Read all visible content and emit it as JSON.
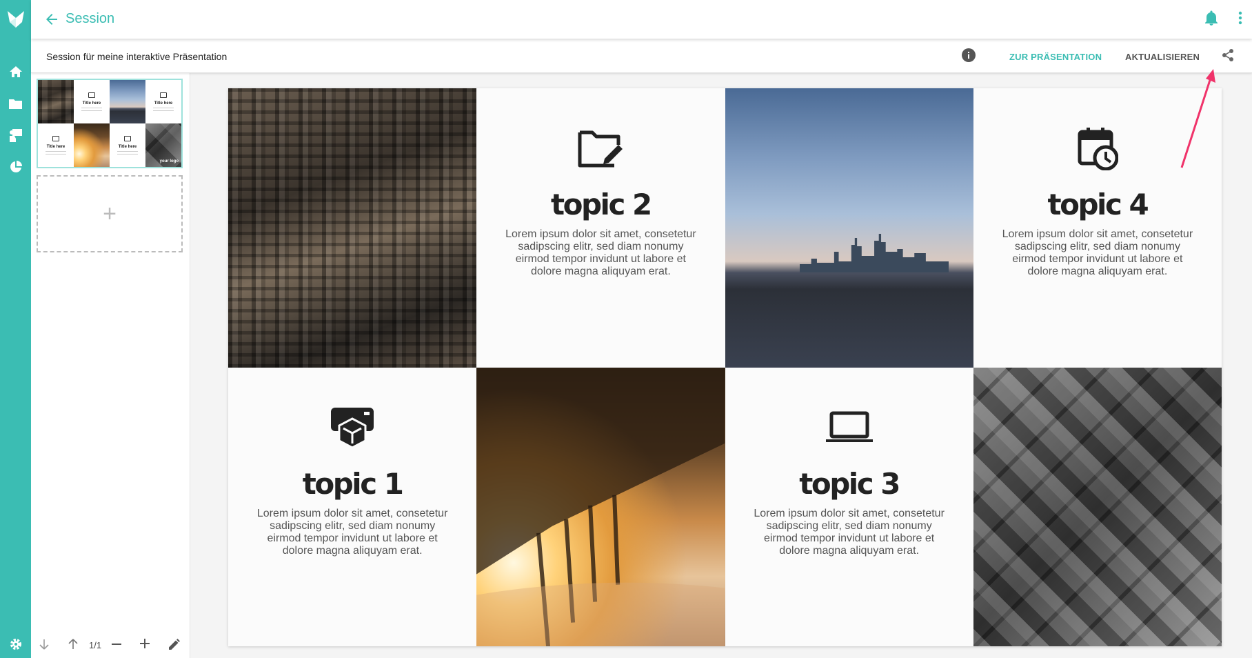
{
  "header": {
    "title": "Session"
  },
  "toolbar": {
    "title": "Session für meine interaktive Präsentation",
    "present_label": "ZUR PRÄSENTATION",
    "update_label": "AKTUALISIEREN"
  },
  "sidebar": {
    "thumbnail_titles": [
      "Title here",
      "Title here",
      "Title here",
      "Title here"
    ],
    "thumbnail_footer": "your logo",
    "add_slide": "+",
    "page_count": "1/1"
  },
  "slide": {
    "cells": [
      {
        "topic": "topic 2",
        "icon": "folder-edit-icon",
        "text": "Lorem ipsum dolor sit amet, consetetur sadipscing elitr, sed diam nonumy eirmod tempor invidunt ut labore et dolore magna aliquyam erat."
      },
      {
        "topic": "topic 4",
        "icon": "calendar-clock-icon",
        "text": "Lorem ipsum dolor sit amet, consetetur sadipscing elitr, sed diam nonumy eirmod tempor invidunt ut labore et dolore magna aliquyam erat."
      },
      {
        "topic": "topic 1",
        "icon": "printer-box-icon",
        "text": "Lorem ipsum dolor sit amet, consetetur sadipscing elitr, sed diam nonumy eirmod tempor invidunt ut labore et dolore magna aliquyam erat."
      },
      {
        "topic": "topic 3",
        "icon": "laptop-icon",
        "text": "Lorem ipsum dolor sit amet, consetetur sadipscing elitr, sed diam nonumy eirmod tempor invidunt ut labore et dolore magna aliquyam erat."
      }
    ]
  },
  "colors": {
    "accent": "#3bbdb3",
    "annotation": "#f0336a"
  }
}
